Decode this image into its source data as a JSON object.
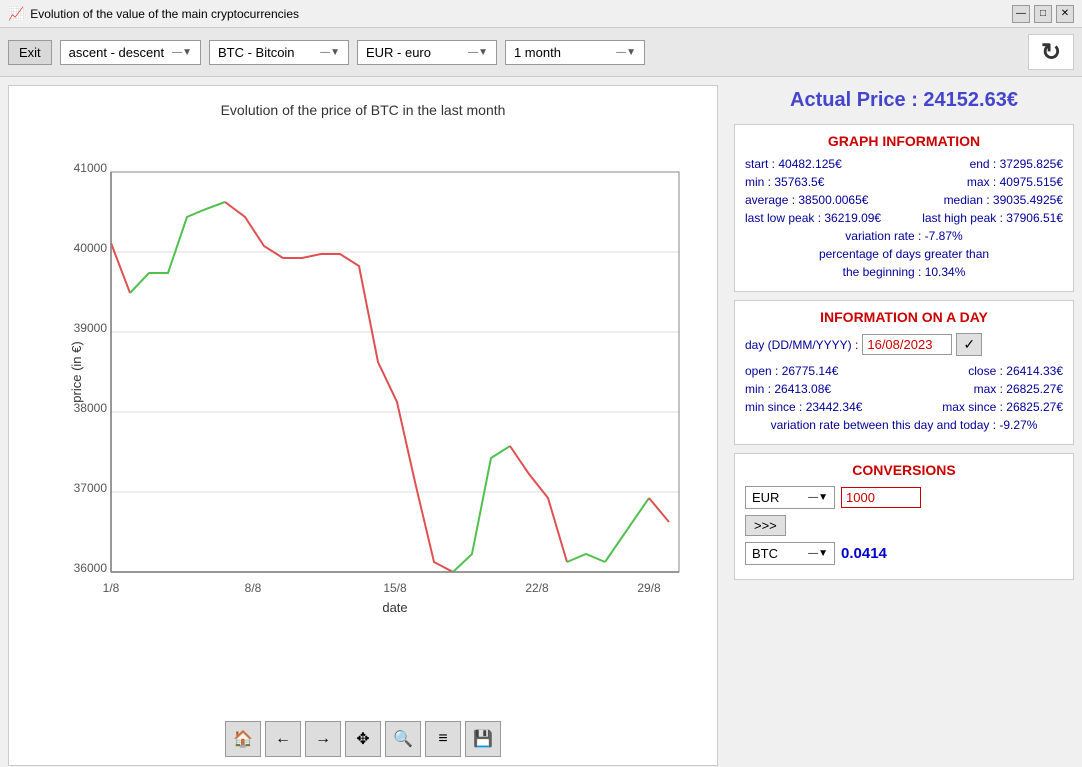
{
  "window": {
    "title": "Evolution of the value of the main cryptocurrencies",
    "icon": "📈"
  },
  "toolbar": {
    "exit_label": "Exit",
    "dropdown_sort": "ascent - descent",
    "dropdown_crypto": "BTC - Bitcoin",
    "dropdown_currency": "EUR - euro",
    "dropdown_period": "1 month",
    "refresh_icon": "↻"
  },
  "chart": {
    "title": "Evolution of the price of BTC in the last month",
    "x_label": "date",
    "y_label": "price (in €)",
    "x_ticks": [
      "1/8",
      "8/8",
      "15/8",
      "22/8",
      "29/8"
    ],
    "y_ticks": [
      "36000",
      "37000",
      "38000",
      "39000",
      "40000",
      "41000"
    ],
    "green_segment_label": "up",
    "red_segment_label": "down"
  },
  "actual_price": {
    "label": "Actual Price : 24152.63€"
  },
  "graph_info": {
    "title": "GRAPH INFORMATION",
    "start_label": "start :",
    "start_val": "40482.125€",
    "end_label": "end :",
    "end_val": "37295.825€",
    "min_label": "min :",
    "min_val": "35763.5€",
    "max_label": "max :",
    "max_val": "40975.515€",
    "average_label": "average :",
    "average_val": "38500.0065€",
    "median_label": "median :",
    "median_val": "39035.4925€",
    "last_low_label": "last low peak :",
    "last_low_val": "36219.09€",
    "last_high_label": "last high peak :",
    "last_high_val": "37906.51€",
    "variation_label": "variation rate :",
    "variation_val": "-7.87%",
    "pct_label": "percentage of days greater than",
    "pct_label2": "the beginning :",
    "pct_val": "10.34%"
  },
  "day_info": {
    "title": "INFORMATION ON A DAY",
    "day_label": "day (DD/MM/YYYY) :",
    "day_value": "16/08/2023",
    "open_label": "open :",
    "open_val": "26775.14€",
    "close_label": "close :",
    "close_val": "26414.33€",
    "min_label": "min :",
    "min_val": "26413.08€",
    "max_label": "max :",
    "max_val": "26825.27€",
    "min_since_label": "min since :",
    "min_since_val": "23442.34€",
    "max_since_label": "max since :",
    "max_since_val": "26825.27€",
    "variation_label": "variation rate between this day and today :",
    "variation_val": "-9.27%"
  },
  "conversions": {
    "title": "CONVERSIONS",
    "from_currency": "EUR",
    "from_value": "1000",
    "arrow_label": ">>>",
    "to_currency": "BTC",
    "to_value": "0.0414"
  },
  "bottom_tools": [
    {
      "name": "home",
      "icon": "🏠"
    },
    {
      "name": "back",
      "icon": "←"
    },
    {
      "name": "forward",
      "icon": "→"
    },
    {
      "name": "move",
      "icon": "✥"
    },
    {
      "name": "zoom",
      "icon": "🔍"
    },
    {
      "name": "settings",
      "icon": "≡"
    },
    {
      "name": "save",
      "icon": "💾"
    }
  ]
}
